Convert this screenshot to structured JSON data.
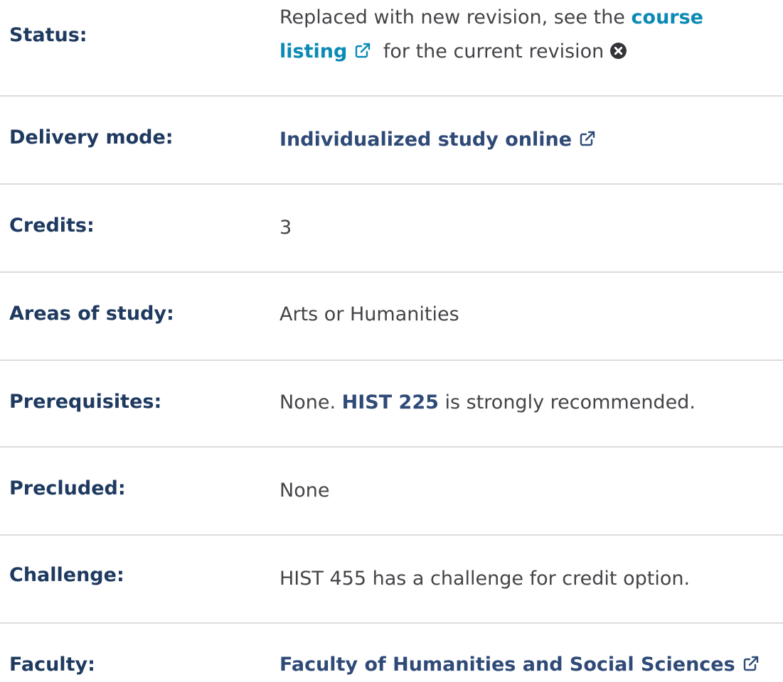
{
  "rows": {
    "status": {
      "label": "Status:",
      "text_before": "Replaced with new revision, see the",
      "link_line1": "course",
      "link_line2": "listing",
      "text_after": "for the current revision",
      "link_icon": "external-link-icon",
      "dismiss_icon": "close-circle-icon"
    },
    "delivery_mode": {
      "label": "Delivery mode:",
      "value": "Individualized study online",
      "icon": "external-link-icon"
    },
    "credits": {
      "label": "Credits:",
      "value": "3"
    },
    "areas_of_study": {
      "label": "Areas of study:",
      "value": "Arts or Humanities"
    },
    "prerequisites": {
      "label": "Prerequisites:",
      "text_before": "None.",
      "link": "HIST 225",
      "text_after": "is strongly recommended."
    },
    "precluded": {
      "label": "Precluded:",
      "value": "None"
    },
    "challenge": {
      "label": "Challenge:",
      "value": "HIST 455 has a challenge for credit option."
    },
    "faculty": {
      "label": "Faculty:",
      "value": "Faculty of Humanities and Social Sciences",
      "icon": "external-link-icon"
    }
  },
  "colors": {
    "label": "#1f3a60",
    "body_text": "#444448",
    "link_teal": "#0a8ab4",
    "link_navy": "#2f4a77",
    "divider": "#dcdce0"
  }
}
